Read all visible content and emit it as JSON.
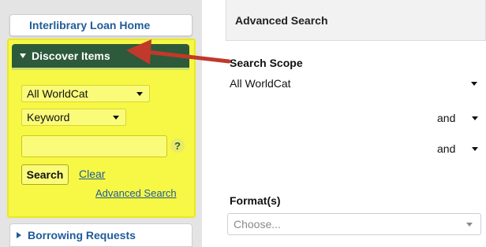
{
  "sidebar": {
    "home_label": "Interlibrary Loan Home",
    "discover": {
      "header_label": "Discover Items",
      "scope_value": "All WorldCat",
      "field_value": "Keyword",
      "search_input_value": "",
      "help_label": "?",
      "search_label": "Search",
      "clear_label": "Clear",
      "advanced_label": "Advanced Search"
    },
    "borrowing_label": "Borrowing Requests"
  },
  "main": {
    "title": "Advanced Search",
    "scope_label": "Search Scope",
    "scope_value": "All WorldCat",
    "operators": [
      "and",
      "and"
    ],
    "format_label": "Format(s)",
    "format_placeholder": "Choose..."
  },
  "annotation": {
    "arrow_color": "#c0392b"
  },
  "colors": {
    "highlight": "#f7f745",
    "discover_header": "#2d5a3a",
    "link": "#1f5c99"
  }
}
